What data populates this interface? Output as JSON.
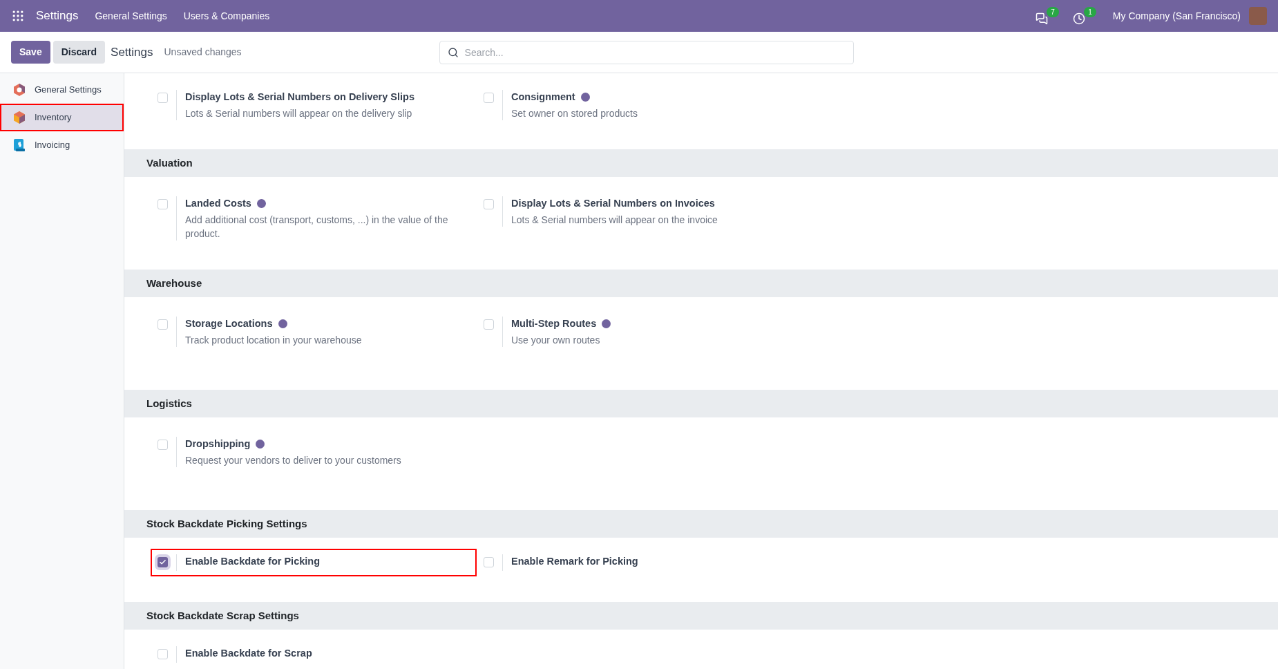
{
  "navbar": {
    "app_title": "Settings",
    "menu": [
      "General Settings",
      "Users & Companies"
    ],
    "messages_count": "7",
    "activities_count": "1",
    "company": "My Company (San Francisco)"
  },
  "control_bar": {
    "save": "Save",
    "discard": "Discard",
    "title": "Settings",
    "status": "Unsaved changes",
    "search": {
      "placeholder": "Search..."
    }
  },
  "sidebar": {
    "items": [
      {
        "label": "General Settings",
        "kind": "general",
        "selected": false,
        "highlighted": false
      },
      {
        "label": "Inventory",
        "kind": "inventory",
        "selected": true,
        "highlighted": true
      },
      {
        "label": "Invoicing",
        "kind": "invoicing",
        "selected": false,
        "highlighted": false
      }
    ]
  },
  "sections": [
    {
      "items": [
        {
          "title": "Display Lots & Serial Numbers on Delivery Slips",
          "help": false,
          "description": "Lots & Serial numbers will appear on the delivery slip",
          "checked": false,
          "highlighted": false
        },
        {
          "title": "Consignment",
          "help": true,
          "description": "Set owner on stored products",
          "checked": false,
          "highlighted": false
        }
      ]
    },
    {
      "title": "Valuation",
      "items": [
        {
          "title": "Landed Costs",
          "help": true,
          "description": "Add additional cost (transport, customs, ...) in the value of the product.",
          "checked": false,
          "highlighted": false
        },
        {
          "title": "Display Lots & Serial Numbers on Invoices",
          "help": false,
          "description": "Lots & Serial numbers will appear on the invoice",
          "checked": false,
          "highlighted": false
        }
      ]
    },
    {
      "title": "Warehouse",
      "items": [
        {
          "title": "Storage Locations",
          "help": true,
          "description": "Track product location in your warehouse",
          "checked": false,
          "highlighted": false
        },
        {
          "title": "Multi-Step Routes",
          "help": true,
          "description": "Use your own routes",
          "checked": false,
          "highlighted": false
        }
      ]
    },
    {
      "title": "Logistics",
      "items": [
        {
          "title": "Dropshipping",
          "help": true,
          "description": "Request your vendors to deliver to your customers",
          "checked": false,
          "highlighted": false
        }
      ]
    },
    {
      "title": "Stock Backdate Picking Settings",
      "items": [
        {
          "title": "Enable Backdate for Picking",
          "help": false,
          "checked": true,
          "highlighted": true
        },
        {
          "title": "Enable Remark for Picking",
          "help": false,
          "checked": false,
          "highlighted": false
        }
      ]
    },
    {
      "title": "Stock Backdate Scrap Settings",
      "items": [
        {
          "title": "Enable Backdate for Scrap",
          "help": false,
          "checked": false,
          "highlighted": false
        }
      ]
    }
  ]
}
